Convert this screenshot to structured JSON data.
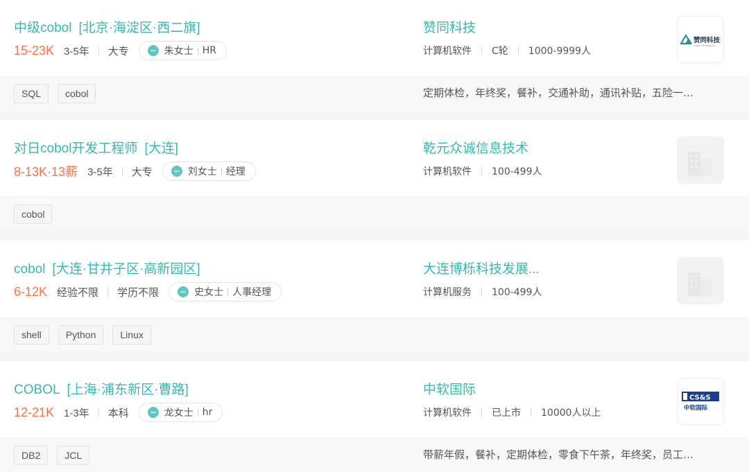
{
  "jobs": [
    {
      "title": "中级cobol",
      "location": "[北京·海淀区·西二旗]",
      "salary": "15-23K",
      "experience": "3-5年",
      "education": "大专",
      "recruiter_name": "朱女士",
      "recruiter_role": "HR",
      "company": "赞同科技",
      "industry": "计算机软件",
      "stage": "C轮",
      "size": "1000-9999人",
      "logo_text": "赞同科技",
      "logo_sub": "AGREE TECHNOLOGY",
      "tags": [
        "SQL",
        "cobol"
      ],
      "welfare": "定期体检，年终奖，餐补，交通补助，通讯补贴，五险一…"
    },
    {
      "title": "对日cobol开发工程师",
      "location": "[大连]",
      "salary": "8-13K·13薪",
      "experience": "3-5年",
      "education": "大专",
      "recruiter_name": "刘女士",
      "recruiter_role": "经理",
      "company": "乾元众诚信息技术",
      "industry": "计算机软件",
      "size": "100-499人",
      "tags": [
        "cobol"
      ],
      "welfare": ""
    },
    {
      "title": "cobol",
      "location": "[大连·甘井子区·高新园区]",
      "salary": "6-12K",
      "experience": "经验不限",
      "education": "学历不限",
      "recruiter_name": "史女士",
      "recruiter_role": "人事经理",
      "company": "大连博栎科技发展...",
      "industry": "计算机服务",
      "size": "100-499人",
      "tags": [
        "shell",
        "Python",
        "Linux"
      ],
      "welfare": ""
    },
    {
      "title": "COBOL",
      "location": "[上海·浦东新区·曹路]",
      "salary": "12-21K",
      "experience": "1-3年",
      "education": "本科",
      "recruiter_name": "龙女士",
      "recruiter_role": "hr",
      "company": "中软国际",
      "industry": "计算机软件",
      "stage": "已上市",
      "size": "10000人以上",
      "logo_text": "CS&S",
      "logo_sub": "中软国际",
      "tags": [
        "DB2",
        "JCL"
      ],
      "welfare": "带薪年假，餐补，定期体检，零食下午茶，年终奖，员工…"
    }
  ],
  "colors": {
    "accent": "#37b8b0",
    "salary": "#fe7140",
    "divider": "#f4f5f7"
  }
}
